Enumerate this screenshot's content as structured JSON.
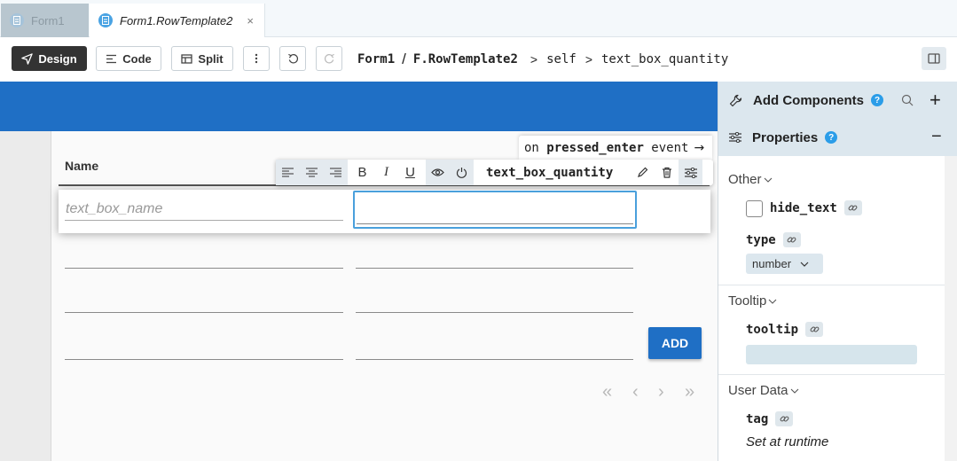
{
  "tabs": [
    {
      "label": "Form1",
      "icon": "form-icon",
      "active": false
    },
    {
      "label": "Form1.RowTemplate2",
      "icon": "form-icon",
      "active": true,
      "close": "×"
    }
  ],
  "toolbar": {
    "design_label": "Design",
    "code_label": "Code",
    "split_label": "Split"
  },
  "breadcrumb": {
    "form": "Form1",
    "slash": "/",
    "template": "F.RowTemplate2",
    "sep1": ">",
    "self": "self",
    "sep2": ">",
    "component": "text_box_quantity"
  },
  "canvas": {
    "column_header": "Name",
    "name_placeholder": "text_box_name",
    "add_button": "ADD",
    "pager": {
      "first": "«",
      "prev": "‹",
      "next": "›",
      "last": "»"
    }
  },
  "format_toolbar": {
    "bold": "B",
    "italic": "I",
    "underline": "U",
    "component_name": "text_box_quantity"
  },
  "event_bar": {
    "prefix": "on ",
    "event": "pressed_enter",
    "suffix": " event",
    "arrow": "→"
  },
  "panel": {
    "add_components": "Add Components",
    "properties": "Properties",
    "help": "?",
    "plus": "+",
    "minus": "−",
    "sections": {
      "other": "Other",
      "tooltip": "Tooltip",
      "user_data": "User Data"
    },
    "props": {
      "hide_text": "hide_text",
      "hide_text_checked": false,
      "type": "type",
      "type_value": "number",
      "tooltip": "tooltip",
      "tooltip_value": "",
      "tag": "tag",
      "tag_value": "Set at runtime"
    }
  },
  "colors": {
    "accent_blue": "#1f6fc5",
    "panel_header": "#dce7ee",
    "selection_border": "#4aa0dc",
    "help_badge": "#2b9de8"
  }
}
